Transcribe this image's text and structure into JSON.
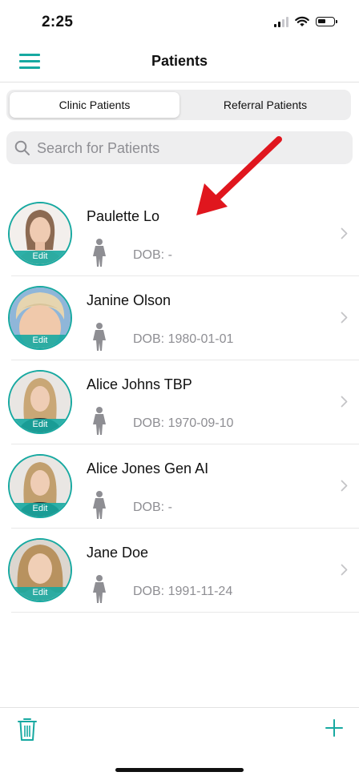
{
  "status_bar": {
    "time": "2:25"
  },
  "nav": {
    "title": "Patients"
  },
  "tabs": [
    {
      "label": "Clinic Patients",
      "selected": true
    },
    {
      "label": "Referral Patients",
      "selected": false
    }
  ],
  "search": {
    "placeholder": "Search for Patients",
    "value": ""
  },
  "patients": [
    {
      "name": "Paulette Lo",
      "dob": "DOB: -",
      "edit_label": "Edit",
      "gender_icon": "female-person-icon"
    },
    {
      "name": "Janine Olson",
      "dob": "DOB: 1980-01-01",
      "edit_label": "Edit",
      "gender_icon": "female-person-icon"
    },
    {
      "name": "Alice Johns TBP",
      "dob": "DOB: 1970-09-10",
      "edit_label": "Edit",
      "gender_icon": "female-person-icon"
    },
    {
      "name": "Alice Jones Gen AI",
      "dob": "DOB: -",
      "edit_label": "Edit",
      "gender_icon": "female-person-icon"
    },
    {
      "name": "Jane Doe",
      "dob": "DOB: 1991-11-24",
      "edit_label": "Edit",
      "gender_icon": "female-person-icon"
    }
  ],
  "toolbar": {
    "delete_icon": "trash-icon",
    "add_icon": "plus-icon"
  },
  "colors": {
    "accent": "#17a9a1",
    "annotation": "#e0161e",
    "secondary_text": "#8e8e93"
  }
}
